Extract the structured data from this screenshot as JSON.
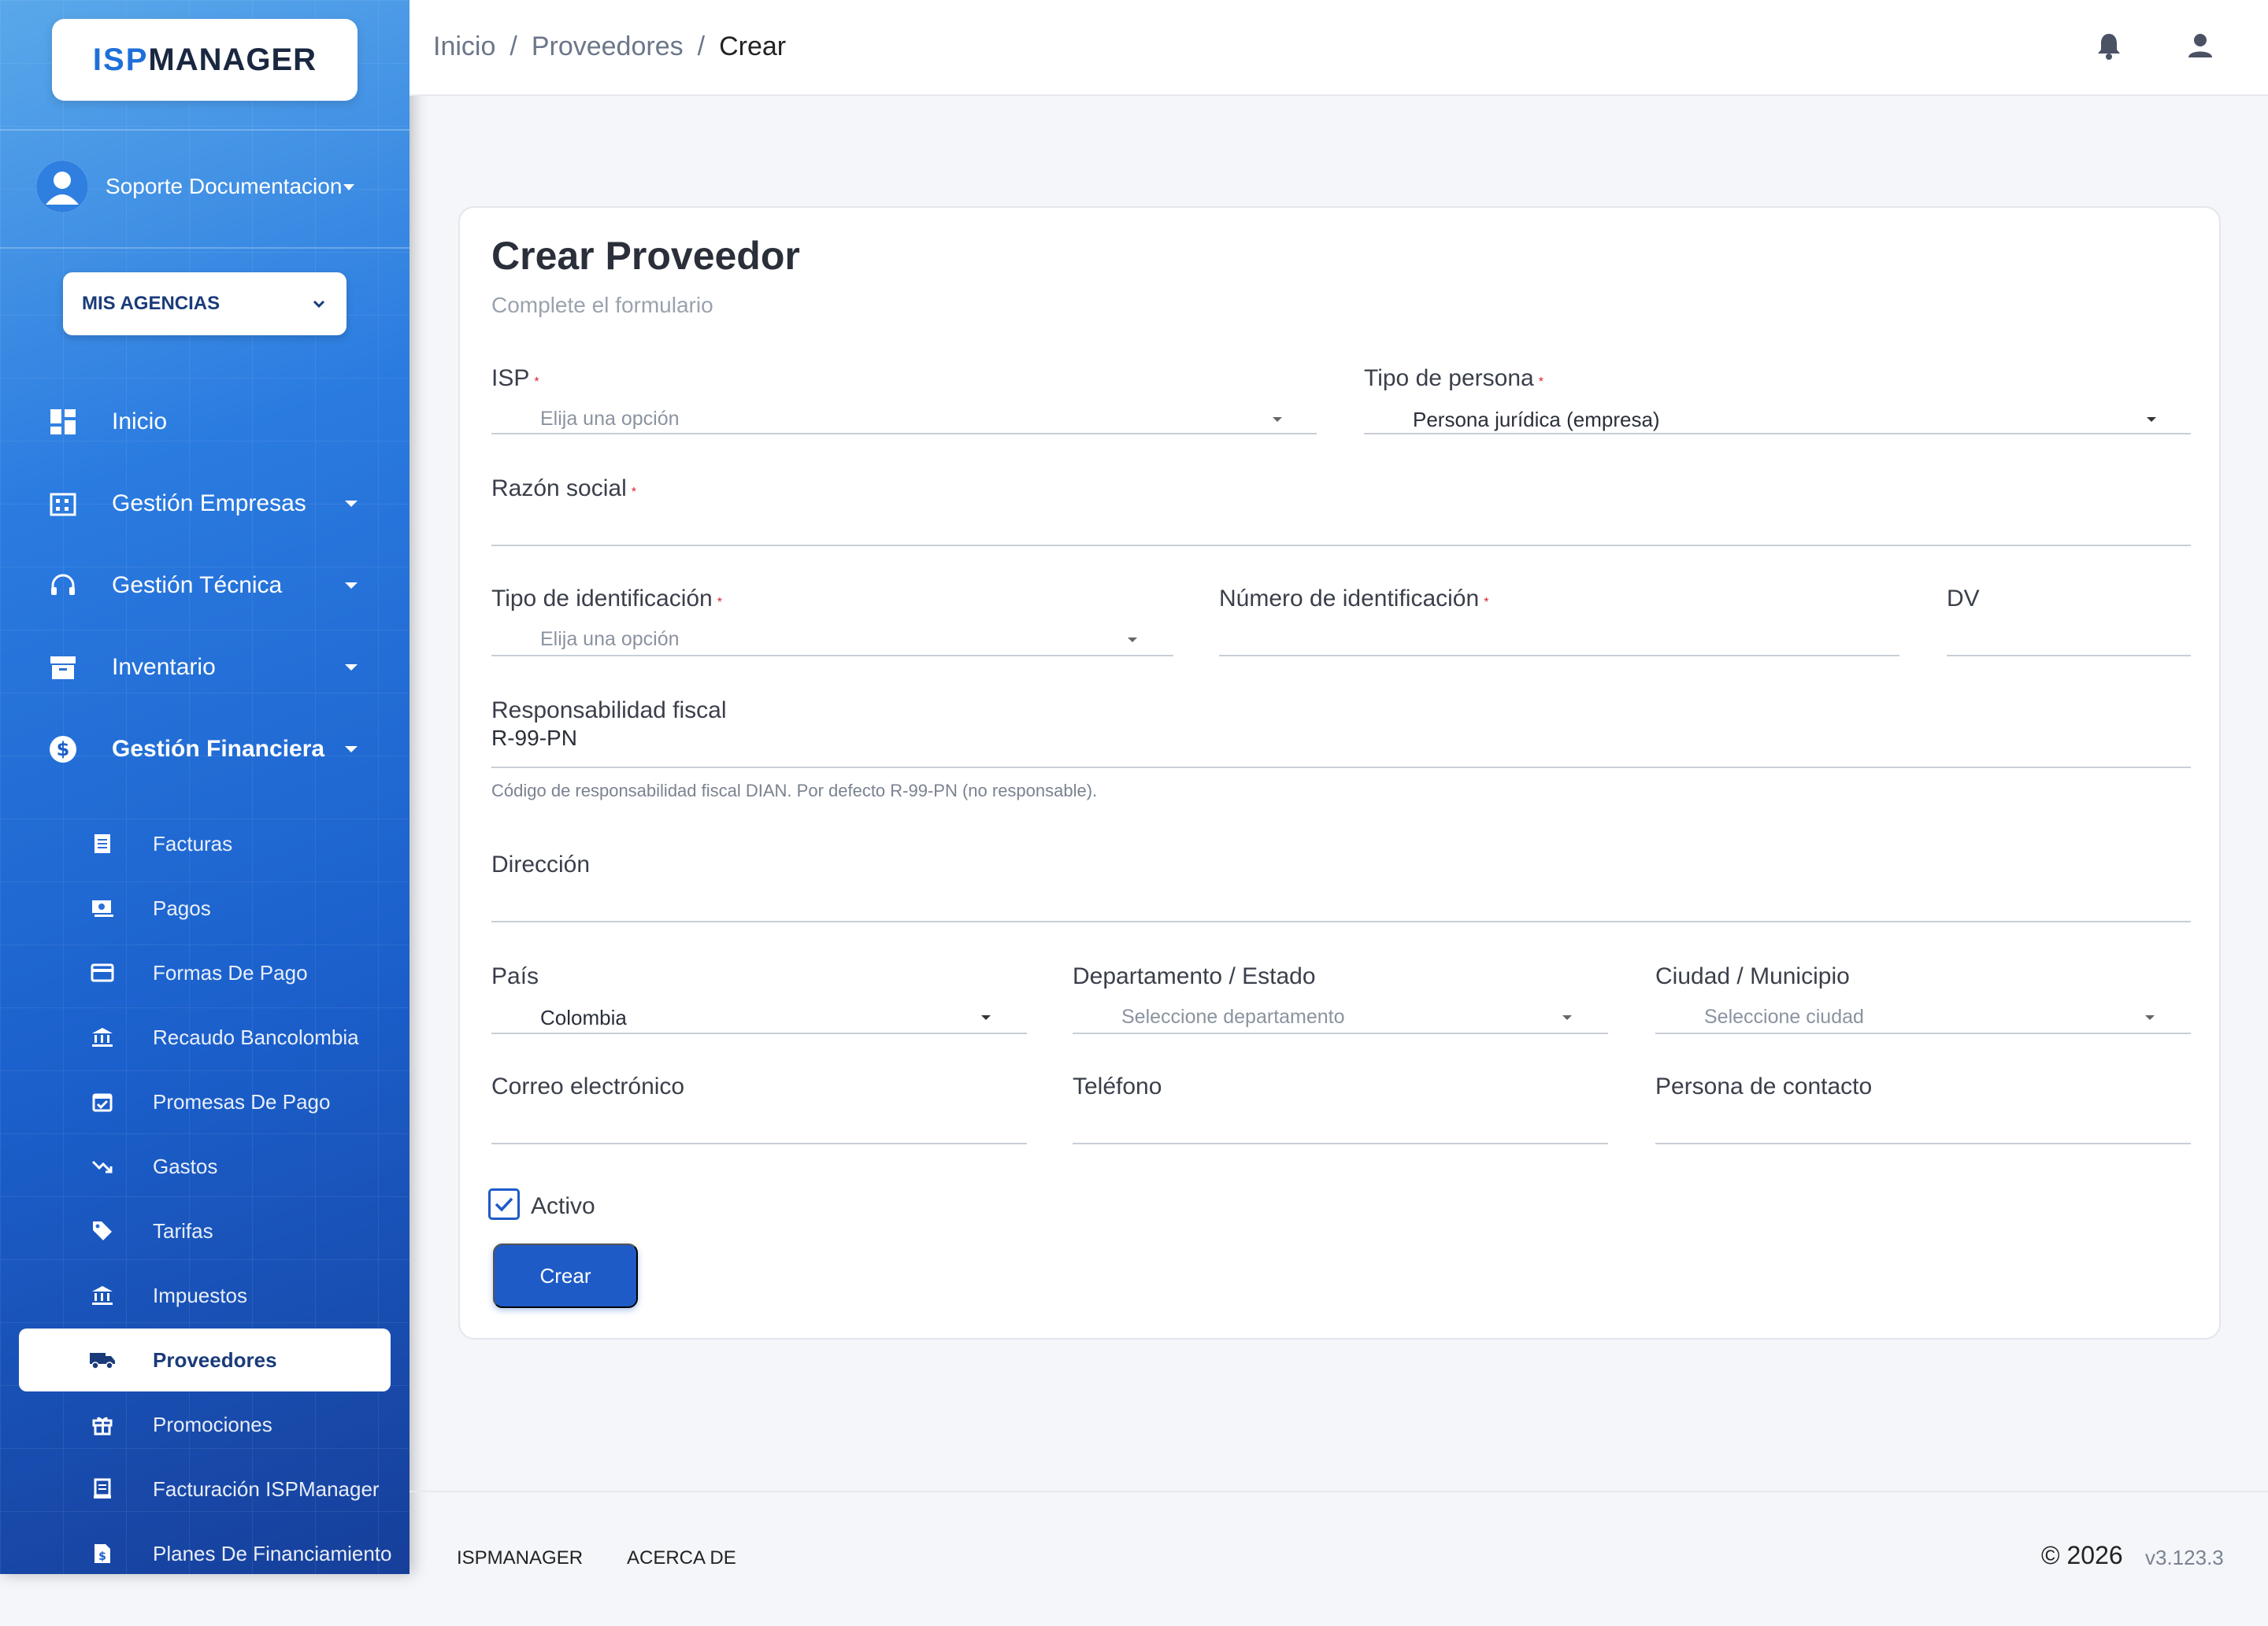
{
  "brand": {
    "logo_prefix": "ISP",
    "logo_suffix": "MANAGER"
  },
  "sidebar": {
    "user_name": "Soporte Documentacion",
    "agencias_label": "MIS AGENCIAS",
    "menu": [
      {
        "label": "Inicio",
        "icon": "dashboard-icon"
      },
      {
        "label": "Gestión Empresas",
        "icon": "building-icon"
      },
      {
        "label": "Gestión Técnica",
        "icon": "headset-icon"
      },
      {
        "label": "Inventario",
        "icon": "archive-icon"
      },
      {
        "label": "Gestión Financiera",
        "icon": "dollar-icon"
      }
    ],
    "submenu": [
      {
        "label": "Facturas",
        "icon": "invoice-icon"
      },
      {
        "label": "Pagos",
        "icon": "cash-icon"
      },
      {
        "label": "Formas De Pago",
        "icon": "card-icon"
      },
      {
        "label": "Recaudo Bancolombia",
        "icon": "bank-icon"
      },
      {
        "label": "Promesas De Pago",
        "icon": "calendar-check-icon"
      },
      {
        "label": "Gastos",
        "icon": "trend-down-icon"
      },
      {
        "label": "Tarifas",
        "icon": "tag-icon"
      },
      {
        "label": "Impuestos",
        "icon": "bank-icon"
      },
      {
        "label": "Proveedores",
        "icon": "truck-icon"
      },
      {
        "label": "Promociones",
        "icon": "gift-icon"
      },
      {
        "label": "Facturación ISPManager",
        "icon": "receipt-icon"
      },
      {
        "label": "Planes De Financiamiento",
        "icon": "file-dollar-icon"
      }
    ],
    "active_submenu": "Proveedores"
  },
  "header": {
    "breadcrumb": [
      "Inicio",
      "Proveedores",
      "Crear"
    ],
    "separator": "/"
  },
  "form": {
    "title": "Crear Proveedor",
    "subtitle": "Complete el formulario",
    "isp": {
      "label": "ISP",
      "placeholder": "Elija una opción"
    },
    "tipo_persona": {
      "label": "Tipo de persona",
      "value": "Persona jurídica (empresa)"
    },
    "razon_social": {
      "label": "Razón social"
    },
    "tipo_identificacion": {
      "label": "Tipo de identificación",
      "placeholder": "Elija una opción"
    },
    "numero_identificacion": {
      "label": "Número de identificación"
    },
    "dv": {
      "label": "DV"
    },
    "responsabilidad_fiscal": {
      "label": "Responsabilidad fiscal",
      "value": "R-99-PN",
      "hint": "Código de responsabilidad fiscal DIAN. Por defecto R-99-PN (no responsable)."
    },
    "direccion": {
      "label": "Dirección"
    },
    "pais": {
      "label": "País",
      "value": "Colombia"
    },
    "departamento": {
      "label": "Departamento / Estado",
      "placeholder": "Seleccione departamento"
    },
    "ciudad": {
      "label": "Ciudad / Municipio",
      "placeholder": "Seleccione ciudad"
    },
    "correo": {
      "label": "Correo electrónico"
    },
    "telefono": {
      "label": "Teléfono"
    },
    "contacto": {
      "label": "Persona de contacto"
    },
    "activo": {
      "label": "Activo",
      "checked": true
    },
    "required_mark": "*",
    "submit_label": "Crear"
  },
  "footer": {
    "links": [
      "ISPMANAGER",
      "ACERCA DE"
    ],
    "copyright": "© 2026",
    "version": "v3.123.3"
  },
  "colors": {
    "primary": "#1e5bc6",
    "required": "#d9232d",
    "sidebar_top": "#5aa8ea",
    "sidebar_bottom": "#163f9a"
  }
}
